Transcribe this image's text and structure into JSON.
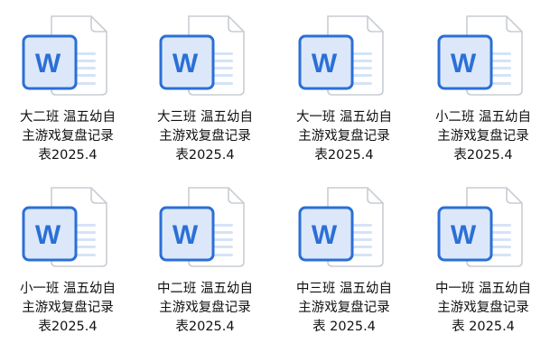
{
  "files": [
    {
      "line1": "大二班 温五幼自",
      "line2": "主游戏复盘记录",
      "line3": "表2025.4",
      "icon": "word-document-icon"
    },
    {
      "line1": "大三班 温五幼自",
      "line2": "主游戏复盘记录",
      "line3": "表2025.4",
      "icon": "word-document-icon"
    },
    {
      "line1": "大一班 温五幼自",
      "line2": "主游戏复盘记录",
      "line3": "表2025.4",
      "icon": "word-document-icon"
    },
    {
      "line1": "小二班 温五幼自",
      "line2": "主游戏复盘记录",
      "line3": "表2025.4",
      "icon": "word-document-icon"
    },
    {
      "line1": "小一班 温五幼自",
      "line2": "主游戏复盘记录",
      "line3": "表2025.4",
      "icon": "word-document-icon"
    },
    {
      "line1": "中二班 温五幼自",
      "line2": "主游戏复盘记录",
      "line3": "表2025.4",
      "icon": "word-document-icon"
    },
    {
      "line1": "中三班 温五幼自",
      "line2": "主游戏复盘记录",
      "line3": "表 2025.4",
      "icon": "word-document-icon"
    },
    {
      "line1": "中一班 温五幼自",
      "line2": "主游戏复盘记录",
      "line3": "表 2025.4",
      "icon": "word-document-icon"
    }
  ],
  "icon_letter": "W",
  "colors": {
    "word_blue": "#2B6FD6",
    "word_blue_light": "#DCE8FA",
    "page_outline": "#C9CDD3",
    "page_lines": "#D5E3F7",
    "text": "#111111"
  }
}
